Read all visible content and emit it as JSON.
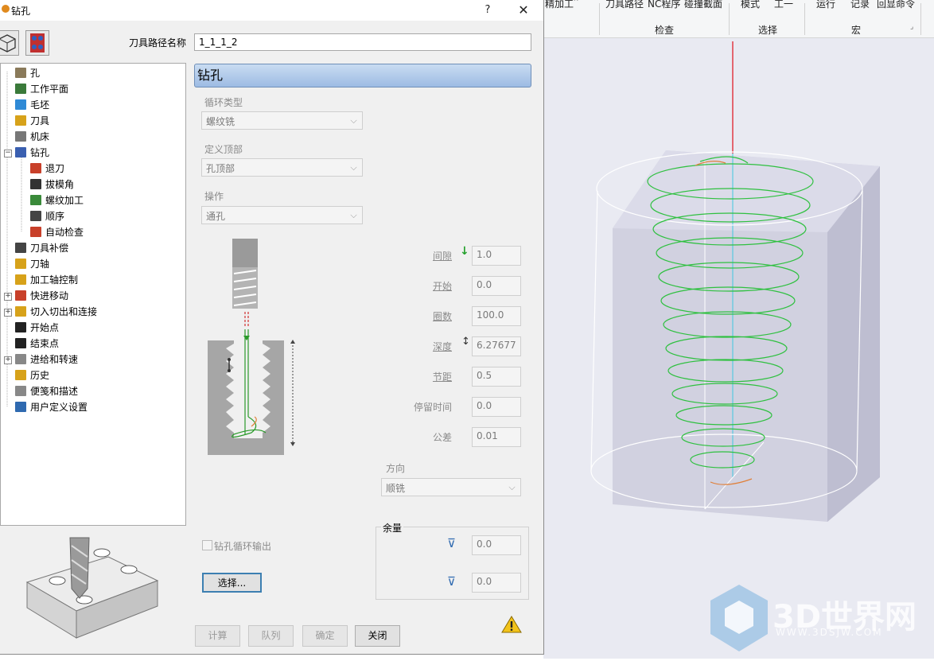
{
  "ribbon": {
    "top_items": [
      "精加工",
      "刀具路径",
      "NC程序",
      "碰撞截面",
      "模式",
      "工一",
      "运行",
      "记录",
      "回显命令"
    ],
    "groups": [
      "检查",
      "选择",
      "宏"
    ]
  },
  "dialog": {
    "title": "钻孔",
    "help_label": "?",
    "close_label": "✕",
    "path_name_label": "刀具路径名称",
    "path_name_value": "1_1_1_2"
  },
  "tree": {
    "items": [
      {
        "label": "孔",
        "icon": "hole-icon",
        "color": "#8a7a5a"
      },
      {
        "label": "工作平面",
        "icon": "workplane-icon",
        "color": "#3a7a3a"
      },
      {
        "label": "毛坯",
        "icon": "block-icon",
        "color": "#2f8ad6"
      },
      {
        "label": "刀具",
        "icon": "tool-icon",
        "color": "#d7a21a"
      },
      {
        "label": "机床",
        "icon": "machine-icon",
        "color": "#777777"
      },
      {
        "label": "钻孔",
        "icon": "drill-icon",
        "color": "#3a5fb0"
      },
      {
        "label": "退刀",
        "icon": "retract-icon",
        "color": "#c8402a"
      },
      {
        "label": "拔模角",
        "icon": "draft-angle-icon",
        "color": "#333333"
      },
      {
        "label": "螺纹加工",
        "icon": "thread-icon",
        "color": "#3a8a3a"
      },
      {
        "label": "顺序",
        "icon": "order-icon",
        "color": "#444444"
      },
      {
        "label": "自动检查",
        "icon": "auto-check-icon",
        "color": "#c8402a"
      },
      {
        "label": "刀具补偿",
        "icon": "tool-comp-icon",
        "color": "#444444"
      },
      {
        "label": "刀轴",
        "icon": "tool-axis-icon",
        "color": "#d7a21a"
      },
      {
        "label": "加工轴控制",
        "icon": "axis-control-icon",
        "color": "#d7a21a"
      },
      {
        "label": "快进移动",
        "icon": "rapid-move-icon",
        "color": "#c8402a"
      },
      {
        "label": "切入切出和连接",
        "icon": "leads-links-icon",
        "color": "#d7a21a"
      },
      {
        "label": "开始点",
        "icon": "start-point-icon",
        "color": "#222222"
      },
      {
        "label": "结束点",
        "icon": "end-point-icon",
        "color": "#222222"
      },
      {
        "label": "进给和转速",
        "icon": "feeds-speeds-icon",
        "color": "#888888"
      },
      {
        "label": "历史",
        "icon": "history-icon",
        "color": "#d7a21a"
      },
      {
        "label": "便笺和描述",
        "icon": "notes-icon",
        "color": "#888888"
      },
      {
        "label": "用户定义设置",
        "icon": "user-settings-icon",
        "color": "#2f6ab0"
      }
    ]
  },
  "section": {
    "title": "钻孔",
    "cycle_type_label": "循环类型",
    "cycle_type_value": "螺纹铣",
    "define_top_label": "定义顶部",
    "define_top_value": "孔顶部",
    "operation_label": "操作",
    "operation_value": "通孔"
  },
  "params": [
    {
      "label": "间隙",
      "value": "1.0",
      "link": true
    },
    {
      "label": "开始",
      "value": "0.0",
      "link": true
    },
    {
      "label": "圈数",
      "value": "100.0",
      "link": true
    },
    {
      "label": "深度",
      "value": "6.27677",
      "link": true
    },
    {
      "label": "节距",
      "value": "0.5",
      "link": true
    },
    {
      "label": "停留时间",
      "value": "0.0",
      "link": false
    },
    {
      "label": "公差",
      "value": "0.01",
      "link": false
    }
  ],
  "direction": {
    "label": "方向",
    "value": "顺铣"
  },
  "drill_cycle_output": {
    "label": "钻孔循环输出",
    "checked": false
  },
  "select_button": "选择...",
  "allowance": {
    "title": "余量",
    "values": [
      "0.0",
      "0.0"
    ]
  },
  "footer": {
    "calculate": "计算",
    "queue": "队列",
    "ok": "确定",
    "close": "关闭"
  },
  "watermark": {
    "brand": "3D世界网",
    "url": "WWW.3DSJW.COM"
  }
}
